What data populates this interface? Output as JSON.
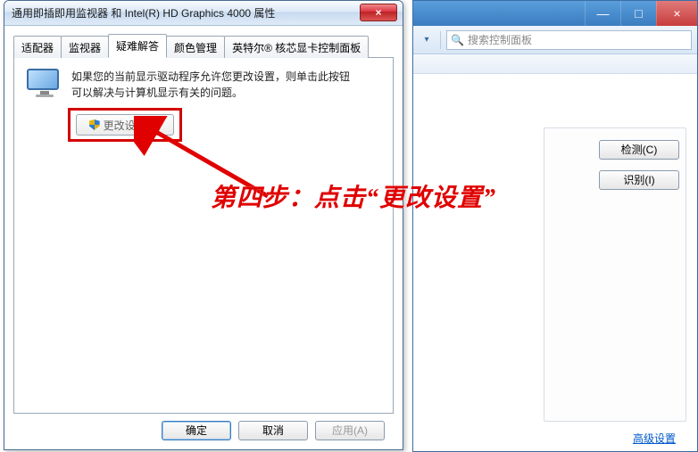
{
  "bg_window": {
    "min": "—",
    "max": "□",
    "close": "×",
    "search_placeholder": "搜索控制面板",
    "detect_btn": "检测(C)",
    "identify_btn": "识别(I)",
    "advanced_link": "高级设置"
  },
  "dialog": {
    "title": "通用即插即用监视器 和 Intel(R) HD Graphics 4000 属性",
    "close": "×",
    "tabs": [
      "适配器",
      "监视器",
      "疑难解答",
      "颜色管理",
      "英特尔® 核芯显卡控制面板"
    ],
    "active_tab_index": 2,
    "info_line1": "如果您的当前显示驱动程序允许您更改设置，则单击此按钮",
    "info_line2": "可以解决与计算机显示有关的问题。",
    "change_btn": "更改设置(C)",
    "ok_btn": "确定",
    "cancel_btn": "取消",
    "apply_btn": "应用(A)"
  },
  "annotation": {
    "text": "第四步：点击“更改设置”"
  }
}
